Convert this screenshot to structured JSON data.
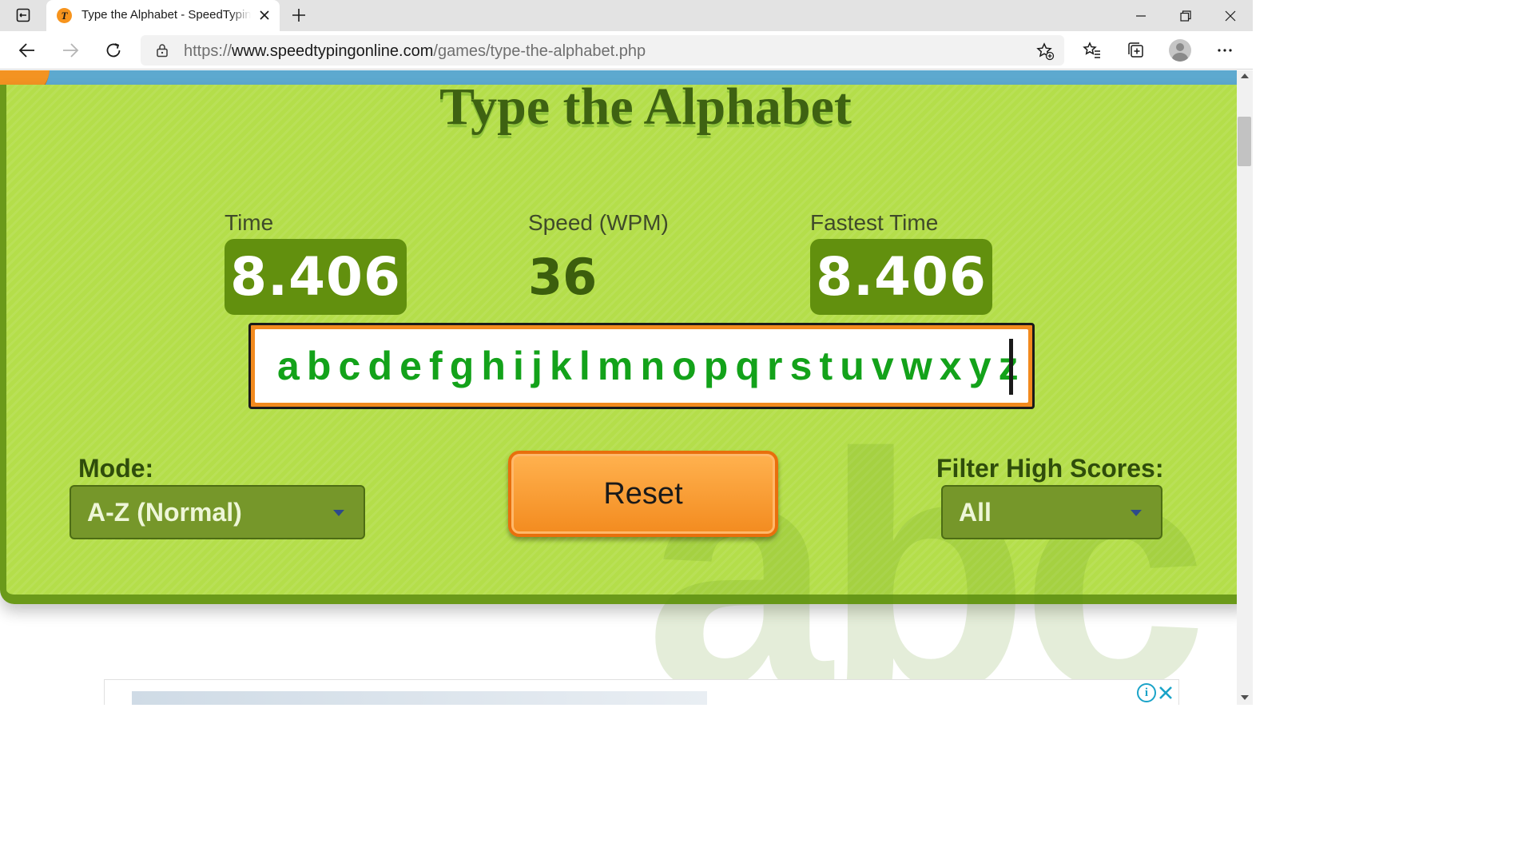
{
  "browser": {
    "tab_title": "Type the Alphabet - SpeedTypingOnline",
    "url_prefix": "https://",
    "url_host": "www.speedtypingonline.com",
    "url_path": "/games/type-the-alphabet.php",
    "favicon_glyph": "T",
    "icons": [
      "tab-actions-icon",
      "close-icon",
      "plus-icon",
      "minimize-icon",
      "restore-icon",
      "window-close-icon",
      "back-arrow-icon",
      "forward-arrow-icon",
      "refresh-icon",
      "lock-icon",
      "add-favorite-icon",
      "favorites-icon",
      "collections-icon",
      "profile-avatar-icon",
      "more-options-icon"
    ]
  },
  "game": {
    "title": "Type the Alphabet",
    "stats": {
      "time_label": "Time",
      "time_value": "8.406",
      "speed_label": "Speed (WPM)",
      "speed_value": "36",
      "fastest_label": "Fastest Time",
      "fastest_value": "8.406"
    },
    "typed_text": "abcdefghijklmnopqrstuvwxyz",
    "mode_label": "Mode:",
    "mode_value": "A-Z (Normal)",
    "reset_label": "Reset",
    "filter_label": "Filter High Scores:",
    "filter_value": "All"
  },
  "ad": {
    "info_glyph": "i"
  },
  "colors": {
    "panel_green": "#b4de4a",
    "stat_box_green": "#62900e",
    "typed_text_green": "#13a21a",
    "input_border_orange": "#f28a1e",
    "reset_orange": "#f38b1f",
    "header_blue": "#5da9cf"
  }
}
